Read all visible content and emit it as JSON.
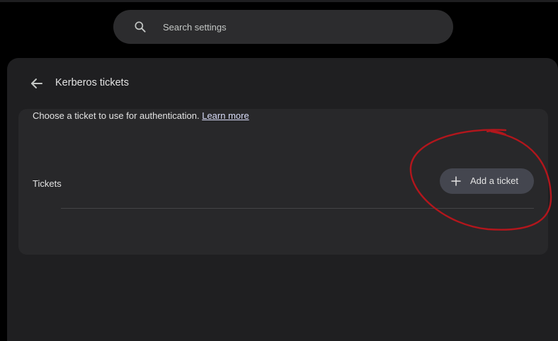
{
  "search": {
    "placeholder": "Search settings",
    "icon": "search-icon"
  },
  "header": {
    "back_icon": "arrow-back-icon",
    "title": "Kerberos tickets"
  },
  "card": {
    "description": "Choose a ticket to use for authentication.",
    "learn_more": "Learn more",
    "tickets_label": "Tickets",
    "add_button_label": "Add a ticket",
    "add_button_icon": "plus-icon"
  },
  "colors": {
    "page_background": "#000000",
    "panel_background": "#1f1f21",
    "card_background": "#28282a",
    "button_background": "#44464f",
    "link": "#d8dcf8",
    "annotation": "#b3161c"
  }
}
